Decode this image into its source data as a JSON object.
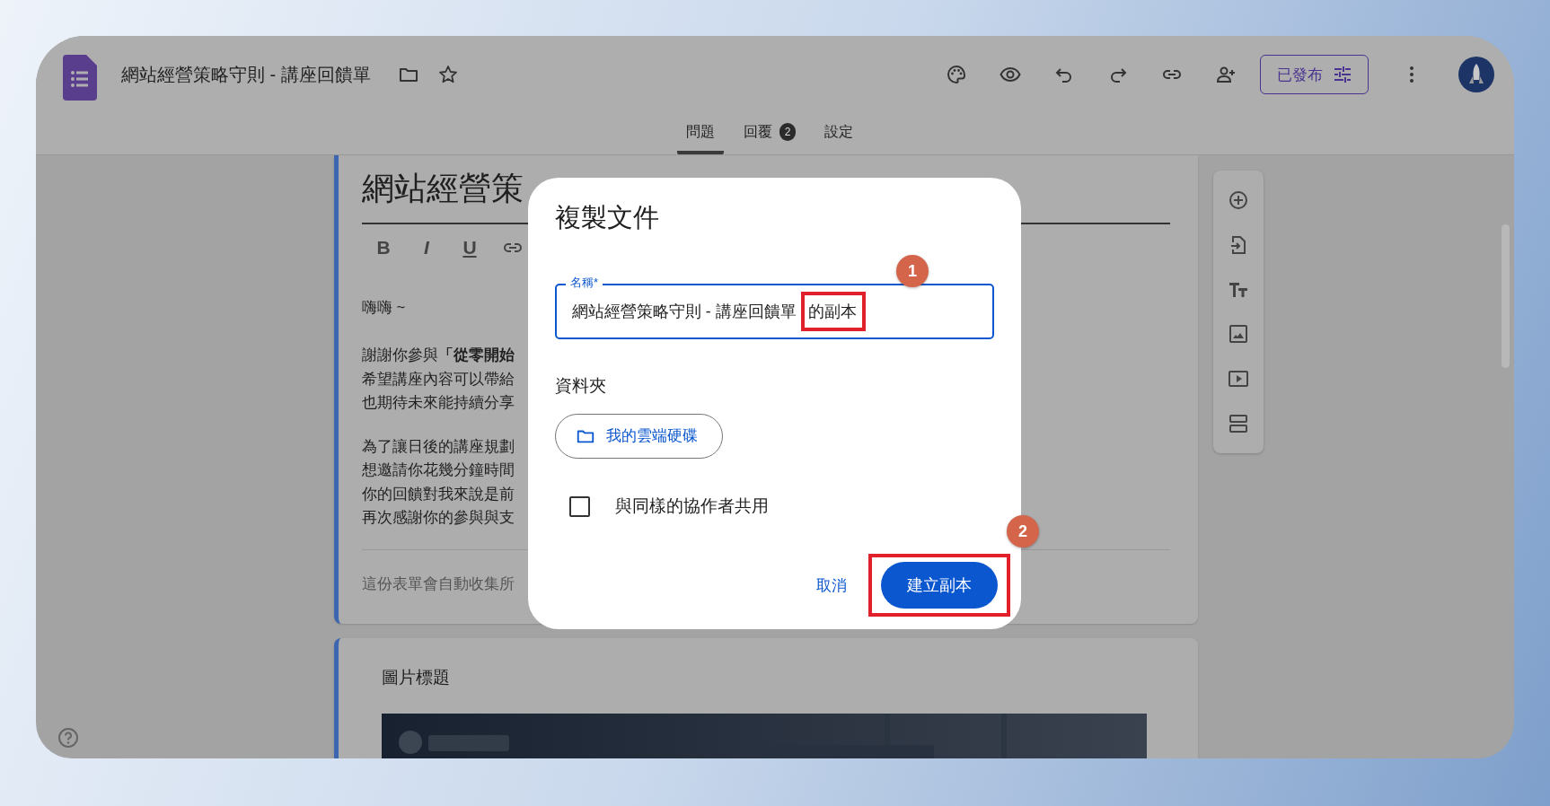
{
  "header": {
    "title": "網站經營策略守則 - 講座回饋單",
    "publish_button": "已發布"
  },
  "tabs": [
    {
      "label": "問題",
      "selected": true
    },
    {
      "label": "回覆",
      "selected": false,
      "badge": "2"
    },
    {
      "label": "設定",
      "selected": false
    }
  ],
  "form_header": {
    "title": "網站經營策",
    "format_buttons": [
      "B",
      "I",
      "U"
    ],
    "greeting": "嗨嗨 ~",
    "paragraphs": [
      [
        "謝謝你參與**「從零開始**",
        "希望講座內容可以帶給",
        "也期待未來能持續分享"
      ],
      [
        "為了讓日後的講座規劃",
        "想邀請你花幾分鐘時間",
        "你的回饋對我來說是前",
        "再次感謝你的參與與支"
      ]
    ],
    "footer": "這份表單會自動收集所"
  },
  "image_section": {
    "title": "圖片標題"
  },
  "dialog": {
    "title": "複製文件",
    "name_field": {
      "label": "名稱*",
      "value_parts": [
        {
          "text": "網站經營策略守則 - 講座回饋單 ",
          "highlighted": false
        },
        {
          "text": "的副本",
          "highlighted": true
        }
      ]
    },
    "folder_label": "資料夾",
    "folder_button": "我的雲端硬碟",
    "share_checkbox": {
      "label": "與同樣的協作者共用",
      "checked": false
    },
    "cancel_button": "取消",
    "create_button": {
      "label": "建立副本",
      "highlighted": true
    }
  },
  "annotations": [
    "1",
    "2"
  ]
}
